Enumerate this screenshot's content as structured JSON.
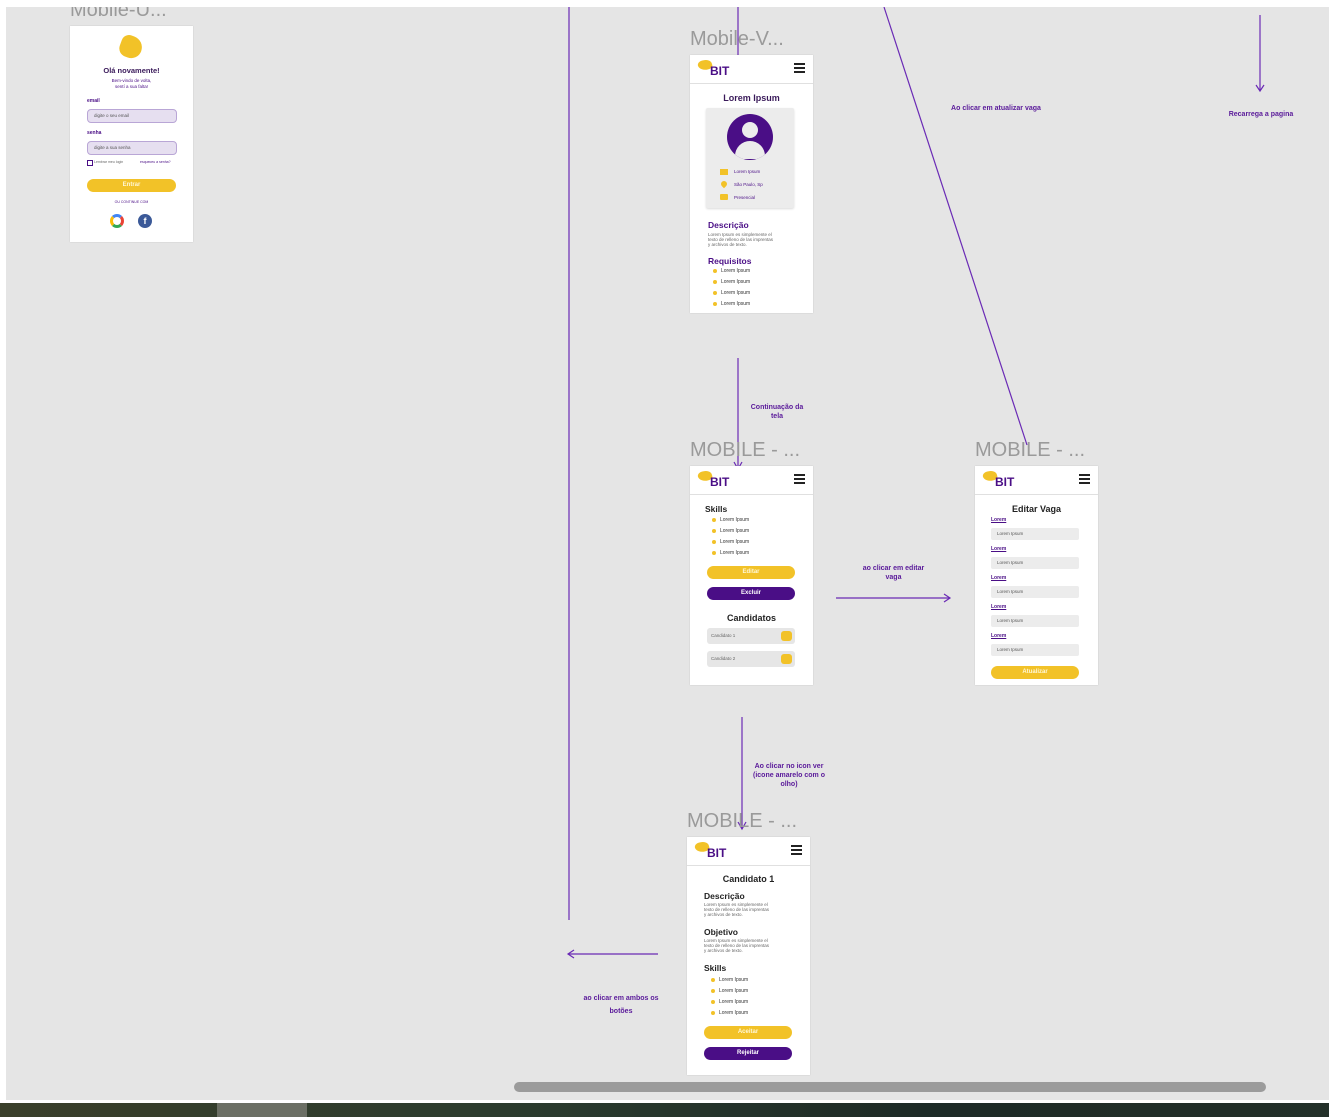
{
  "frames": {
    "login": {
      "title": "Mobile-U...",
      "heading": "Olá novamente!",
      "subtitle_1": "Bem-vindo de volta,",
      "subtitle_2": "sentí a sua falta!",
      "email_label": "email",
      "email_placeholder": "digite o seu email",
      "password_label": "senha",
      "password_placeholder": "digite a sua senha",
      "remember": "Lembrar meu login",
      "forgot": "esqueceu a senha?",
      "submit": "Entrar",
      "divider": "OU CONTINUE COM"
    },
    "vaga": {
      "title": "Mobile-V...",
      "logo": "BIT",
      "heading": "Lorem Ipsum",
      "info_1": "Lorem Ipsum",
      "info_2": "São Paulo, Sp",
      "info_3": "Presencial",
      "desc_title": "Descrição",
      "desc_1": "Lorem Ipsum es simplemente el",
      "desc_2": "texto de relleno de las imprentas",
      "desc_3": "y archivos de texto.",
      "req_title": "Requisitos",
      "req_items": [
        "Lorem Ipsum",
        "Lorem Ipsum",
        "Lorem Ipsum",
        "Lorem Ipsum"
      ]
    },
    "skills": {
      "title": "MOBILE - ...",
      "logo": "BIT",
      "skills_title": "Skills",
      "skills_items": [
        "Lorem Ipsum",
        "Lorem Ipsum",
        "Lorem Ipsum",
        "Lorem Ipsum"
      ],
      "edit": "Editar",
      "delete": "Excluir",
      "candidates_title": "Candidatos",
      "candidate_1": "Candidato 1",
      "candidate_2": "Candidato 2"
    },
    "edit": {
      "title": "MOBILE - ...",
      "logo": "BIT",
      "heading": "Editar Vaga",
      "fields": [
        {
          "label": "Lorem",
          "value": "Lorem Ipsum"
        },
        {
          "label": "Lorem",
          "value": "Lorem Ipsum"
        },
        {
          "label": "Lorem",
          "value": "Lorem Ipsum"
        },
        {
          "label": "Lorem",
          "value": "Lorem Ipsum"
        },
        {
          "label": "Lorem",
          "value": "Lorem Ipsum"
        }
      ],
      "submit": "Atualizar"
    },
    "candidate": {
      "title": "MOBILE - ...",
      "logo": "BIT",
      "heading": "Candidato 1",
      "desc_title": "Descrição",
      "desc_1": "Lorem Ipsum es simplemente el",
      "desc_2": "texto de relleno de las imprentas",
      "desc_3": "y archivos de texto.",
      "obj_title": "Objetivo",
      "obj_1": "Lorem Ipsum es simplemente el",
      "obj_2": "texto de relleno de las imprentas",
      "obj_3": "y archivos de texto.",
      "skills_title": "Skills",
      "skills_items": [
        "Lorem Ipsum",
        "Lorem Ipsum",
        "Lorem Ipsum",
        "Lorem Ipsum"
      ],
      "accept": "Aceitar",
      "reject": "Rejeitar"
    }
  },
  "annotations": {
    "atualizar": "Ao clicar em atualizar vaga",
    "recarrega": "Recarrega a pagina",
    "continuacao_1": "Continuação da",
    "continuacao_2": "tela",
    "editar_1": "ao clicar em editar",
    "editar_2": "vaga",
    "icon_1": "Ao clicar no icon ver",
    "icon_2": "(icone amarelo com o",
    "icon_3": "olho)",
    "ambos_1": "ao clicar em ambos os",
    "ambos_2": "botões"
  },
  "colors": {
    "brand_purple": "#4a0e86",
    "brand_yellow": "#f2c228",
    "canvas": "#e5e5e5"
  }
}
